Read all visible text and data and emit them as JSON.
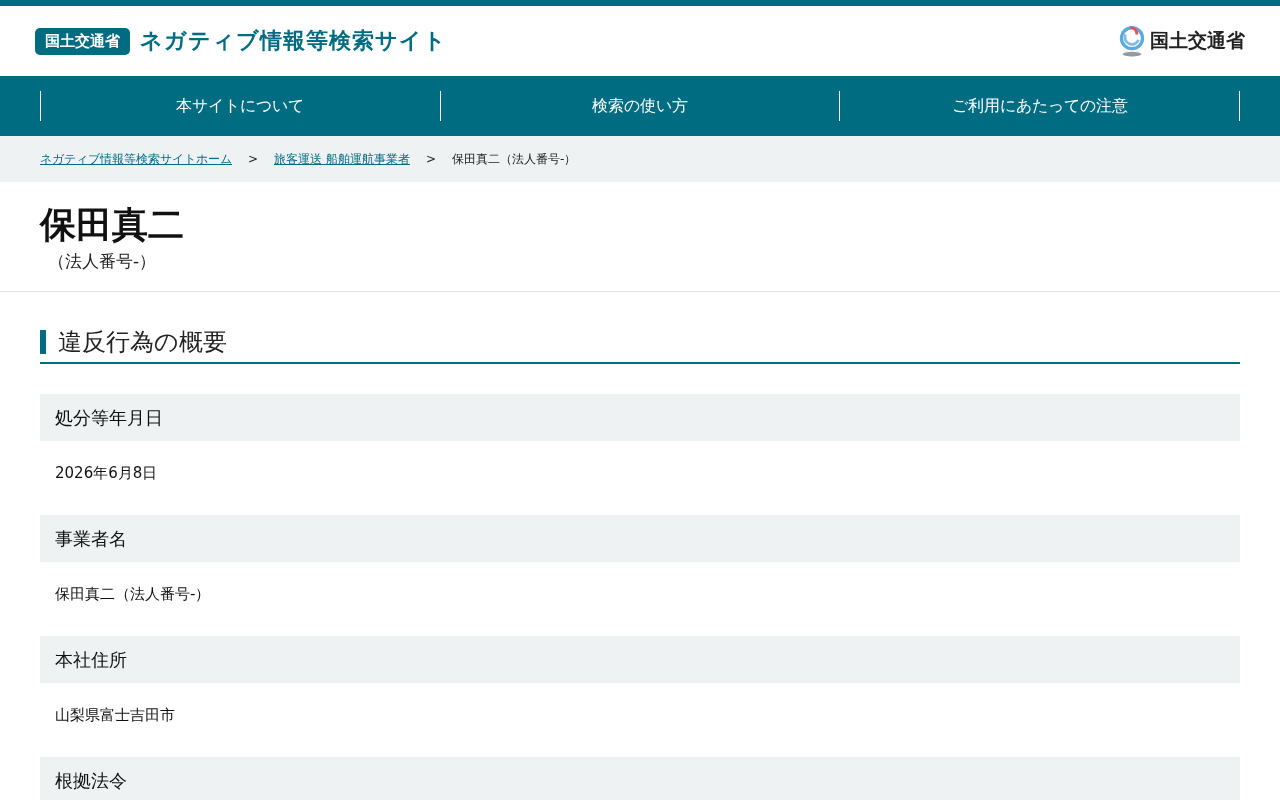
{
  "header": {
    "badge": "国土交通省",
    "site_title": "ネガティブ情報等検索サイト",
    "ministry_logo_text": "国土交通省"
  },
  "nav": [
    {
      "label": "本サイトについて"
    },
    {
      "label": "検索の使い方"
    },
    {
      "label": "ご利用にあたっての注意"
    }
  ],
  "breadcrumb": [
    {
      "label": "ネガティブ情報等検索サイトホーム",
      "link": true
    },
    {
      "separator": ">",
      "label": "旅客運送 船舶運航事業者",
      "link": true
    },
    {
      "separator": ">",
      "label": "保田真二（法人番号-）",
      "link": false
    }
  ],
  "page_title": "保田真二",
  "page_subtitle": "（法人番号-）",
  "section_heading": "違反行為の概要",
  "fields": [
    {
      "label": "処分等年月日",
      "value": "2026年6月8日"
    },
    {
      "label": "事業者名",
      "value": "保田真二（法人番号-）"
    },
    {
      "label": "本社住所",
      "value": "山梨県富士吉田市"
    },
    {
      "label": "根拠法令"
    }
  ]
}
